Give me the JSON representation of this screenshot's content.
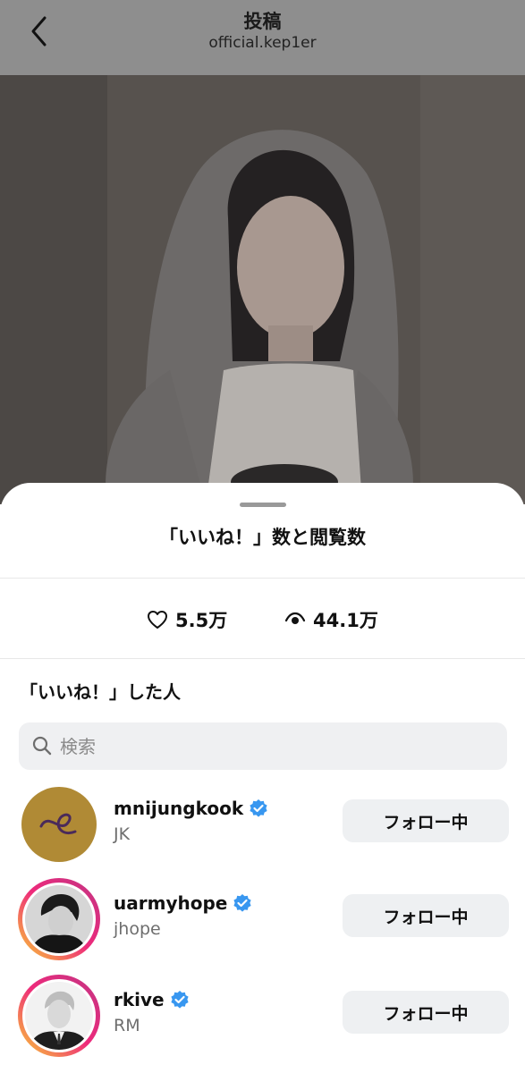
{
  "header": {
    "title": "投稿",
    "username": "official.kep1er"
  },
  "sheet": {
    "title": "「いいね！」数と閲覧数",
    "stats": {
      "likes": "5.5万",
      "views": "44.1万"
    },
    "section_label": "「いいね！」した人",
    "search": {
      "placeholder": "検索"
    },
    "users": [
      {
        "username": "mnijungkook",
        "name": "JK",
        "button": "フォロー中",
        "verified": true,
        "story_ring": false
      },
      {
        "username": "uarmyhope",
        "name": "jhope",
        "button": "フォロー中",
        "verified": true,
        "story_ring": true
      },
      {
        "username": "rkive",
        "name": "RM",
        "button": "フォロー中",
        "verified": true,
        "story_ring": true
      }
    ]
  },
  "colors": {
    "verified": "#3897f0",
    "story_ring_start": "#f9ce34",
    "story_ring_mid": "#ee2a7b",
    "story_ring_end": "#c13584",
    "header_bg": "#8e8e8e",
    "jk_avatar_bg": "#b08a35"
  },
  "icons": {
    "back": "chevron-left-icon",
    "likes": "heart-icon",
    "views": "eye-icon",
    "search": "search-icon",
    "verified": "verified-badge-icon"
  }
}
